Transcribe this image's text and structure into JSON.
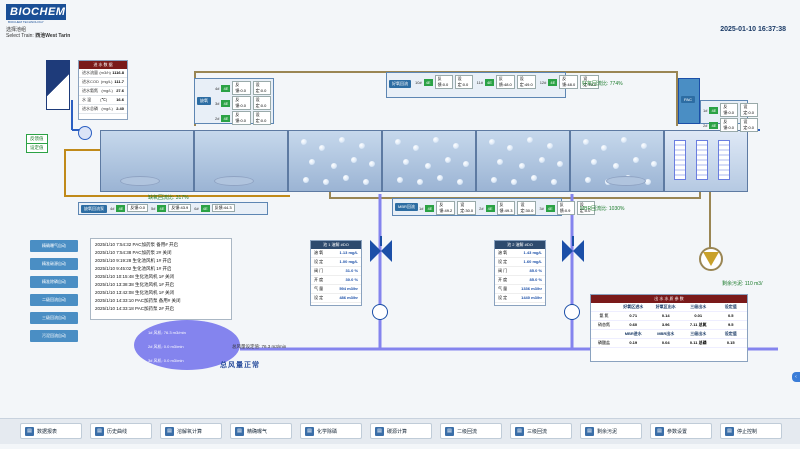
{
  "header": {
    "logo": "BIOCHEM",
    "logo_sub": "BIOCHEM TECHNOLOGY",
    "train_label": "选择池组",
    "train_prefix": "Select Train:",
    "train_value": "西池West Tarin",
    "datetime": "2025-01-10 16:37:38"
  },
  "influent": {
    "title": "进 水 数 据",
    "rows": [
      {
        "label": "进水流量",
        "unit": "(m3/h)",
        "value": "1116.8"
      },
      {
        "label": "进水COD",
        "unit": "(mg/L)",
        "value": "111.7"
      },
      {
        "label": "进水氨氮",
        "unit": "(mg/L)",
        "value": "27.6"
      },
      {
        "label": "水  温",
        "unit": "(℃)",
        "value": "16.6"
      },
      {
        "label": "进水总磷",
        "unit": "(mg/L)",
        "value": "2.40"
      }
    ]
  },
  "anoxic": {
    "tag": "缺氧",
    "rows": [
      {
        "id": "4#",
        "a": "反馈:0.0",
        "b": "设定:0.0"
      },
      {
        "id": "3#",
        "a": "反馈:0.0",
        "b": "设定:0.0"
      },
      {
        "id": "2#",
        "a": "反馈:0.0",
        "b": "设定:0.0"
      }
    ]
  },
  "aerobic_top": {
    "tag": "好氧回流",
    "rows": [
      {
        "id": "10#",
        "a": "反馈:0.0",
        "b": "设定:0.0"
      },
      {
        "id": "11#",
        "a": "反馈:48.0",
        "b": "设定:49.0"
      },
      {
        "id": "12#",
        "a": "反馈:48.0",
        "b": "设定:49.0"
      }
    ],
    "reflux_rate": "好氧回流比: 774%"
  },
  "pac": {
    "tag": "PAC",
    "rows": [
      {
        "id": "1#",
        "a": "反馈:0.0",
        "b": "设定:0.0"
      },
      {
        "id": "2#",
        "a": "反馈:0.0",
        "b": "设定:0.0"
      }
    ]
  },
  "side_buttons_top": [
    {
      "label": "反馈值"
    },
    {
      "label": "设定值"
    }
  ],
  "anoxic_reflux": {
    "label": "缺氧回流比: 317%",
    "tag": "缺氧回流泵",
    "rows": [
      {
        "id": "4#",
        "a": "反馈:0.0"
      },
      {
        "id": "5#",
        "a": "反馈:43.9"
      },
      {
        "id": "6#",
        "a": "反馈:44.3"
      }
    ]
  },
  "mbr": {
    "tag": "MBR回流",
    "rows": [
      {
        "id": "1#",
        "a": "反馈:49.2",
        "b": "设定:30.0"
      },
      {
        "id": "2#",
        "a": "反馈:49.3",
        "b": "设定:30.0"
      },
      {
        "id": "3#",
        "a": "反馈:0.9",
        "b": "设定:0.0"
      }
    ],
    "reflux_rate": "MBR回流比: 1030%"
  },
  "do1": {
    "title": "池 1 溶解 #DO",
    "rows": [
      {
        "label": "溶 氧",
        "value": "1.13 mg/L"
      },
      {
        "label": "设 定",
        "value": "1.00 mg/L"
      },
      {
        "label": "阀 门",
        "value": "31.0 %"
      },
      {
        "label": "开 度",
        "value": "30.0 %"
      },
      {
        "label": "气 量",
        "value": "594 m3/hr"
      },
      {
        "label": "设 定",
        "value": "486 m3/hr"
      }
    ]
  },
  "do2": {
    "title": "池 2 溶解 #DO",
    "rows": [
      {
        "label": "溶 氧",
        "value": "1.43 mg/L"
      },
      {
        "label": "设 定",
        "value": "1.60 mg/L"
      },
      {
        "label": "阀 门",
        "value": "85.0 %"
      },
      {
        "label": "开 度",
        "value": "85.0 %"
      },
      {
        "label": "气 量",
        "value": "1336 m3/hr"
      },
      {
        "label": "设 定",
        "value": "1440 m3/hr"
      }
    ]
  },
  "left_buttons": [
    {
      "label": "精确曝气自动"
    },
    {
      "label": "精准碳源自动"
    },
    {
      "label": "精准除磷自动"
    },
    {
      "label": "二级回流自动"
    },
    {
      "label": "三级回流自动"
    },
    {
      "label": "污泥回流自动"
    }
  ],
  "logs": [
    "2025/1/10 7:54:32 PAC加药泵 备用# 开启",
    "2025/1/10 7:54:38 PAC加药泵 2# 关闭",
    "2025/1/10 9:19:28 生化池风机 1# 开启",
    "2025/1/10 9:45:02 生化池风机 1# 开启",
    "2025/1/10 10:15:48 生化池风机 1# 关闭",
    "2025/1/10 13:38:38 生化池风机 1# 开启",
    "2025/1/10 13:42:08 生化池风机 1# 关闭",
    "2025/1/10 14:33:10 PAC加药泵 备用# 关闭",
    "2025/1/10 14:33:18 PAC加药泵 2# 开启"
  ],
  "blowers": {
    "rows": [
      "1# 风机: 76.3 m3/min",
      "2# 风机: 0.0 m3/min",
      "3# 风机: 0.0 m3/min"
    ],
    "total_label": "总风量设定值: 76.3 m3/min",
    "status": "总风量正常"
  },
  "effluent_flow": "剩余污泥: 110 m3/",
  "params": {
    "title": "出 水 水 质 参 数",
    "headers1": [
      "好氧区进水",
      "好氧区出水",
      "三级出水",
      "设定值"
    ],
    "rows1": [
      {
        "label": "氨 氮",
        "values": [
          "0.71",
          "0.14",
          "0.01",
          "0.5"
        ]
      },
      {
        "label": "硝态氮",
        "values": [
          "0.60",
          "3.96",
          "7.11 总氮",
          "9.5"
        ]
      }
    ],
    "headers2": [
      "MBR进水",
      "MBR出水",
      "三级出水",
      "设定值"
    ],
    "rows2": [
      {
        "label": "磷酸盐",
        "values": [
          "0.19",
          "0.04",
          "0.11 总磷",
          "0.15"
        ]
      }
    ]
  },
  "bottom_nav": [
    {
      "label": "数据报表",
      "icon": "report-icon"
    },
    {
      "label": "历史曲线",
      "icon": "chart-icon"
    },
    {
      "label": "溶解氧计算",
      "icon": "calc-icon"
    },
    {
      "label": "精确曝气",
      "icon": "aeration-icon"
    },
    {
      "label": "化学除磷",
      "icon": "chemical-icon"
    },
    {
      "label": "碳源计算",
      "icon": "carbon-icon"
    },
    {
      "label": "二级回流",
      "icon": "reflux-icon"
    },
    {
      "label": "三级回流",
      "icon": "reflux3-icon"
    },
    {
      "label": "剩余污泥",
      "icon": "sludge-icon"
    },
    {
      "label": "参数设置",
      "icon": "settings-icon"
    },
    {
      "label": "停止控制",
      "icon": "power-icon"
    }
  ],
  "colors": {
    "pipe_brown": "#9a8654",
    "pipe_blue": "#2b5fc2",
    "air_purple": "#8484ee",
    "valve_blue": "#1b4fa8",
    "reflux_orange": "#c08a1a",
    "accent_red": "#7a1a1a"
  }
}
